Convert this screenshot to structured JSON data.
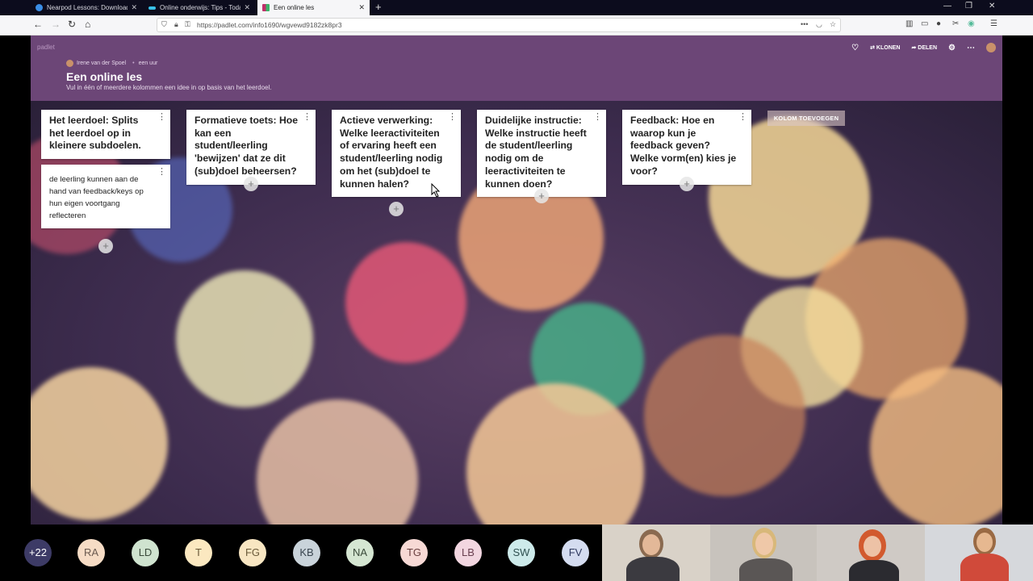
{
  "browser": {
    "tabs": [
      {
        "title": "Nearpod Lessons: Download e",
        "favicon_color": "#3a8ee6"
      },
      {
        "title": "Online onderwijs: Tips - Today",
        "favicon_color": "#39c0e8"
      },
      {
        "title": "Een online les",
        "favicon_color": "#c0306a"
      }
    ],
    "url": "https://padlet.com/info1690/wgvewd9182zk8pr3"
  },
  "padlet": {
    "brand": "padlet",
    "author": "Irene van der Spoel",
    "time": "een uur",
    "title": "Een online les",
    "description": "Vul in één of meerdere kolommen een idee in op basis van het leerdoel.",
    "actions": {
      "clone": "KLONEN",
      "share": "DELEN"
    },
    "add_column": "KOLOM TOEVOEGEN",
    "columns": [
      {
        "heading": "Het leerdoel: Splits het leerdoel op in kleinere subdoelen.",
        "posts": [
          "de leerling kunnen aan de hand van feedback/keys op hun eigen voortgang reflecteren"
        ]
      },
      {
        "heading": "Formatieve toets: Hoe kan een student/leerling 'bewijzen' dat ze dit (sub)doel beheersen?",
        "posts": []
      },
      {
        "heading": "Actieve verwerking: Welke leeractiviteiten of ervaring heeft een student/leerling nodig om het (sub)doel te kunnen halen?",
        "posts": []
      },
      {
        "heading": "Duidelijke instructie: Welke instructie heeft de student/leerling nodig om de leeractiviteiten te kunnen doen?",
        "posts": []
      },
      {
        "heading": "Feedback: Hoe en waarop kun je feedback geven? Welke vorm(en) kies je voor?",
        "posts": []
      }
    ]
  },
  "meeting": {
    "participants": [
      {
        "initials": "+22",
        "color": "#3d3b66",
        "text_color": "#ffffff"
      },
      {
        "initials": "RA",
        "color": "#f6dcc5",
        "text_color": "#6a5a50"
      },
      {
        "initials": "LD",
        "color": "#cfe3cf",
        "text_color": "#3a4a3a"
      },
      {
        "initials": "T",
        "color": "#fbe8c0",
        "text_color": "#6a5a3a"
      },
      {
        "initials": "FG",
        "color": "#f8e6c2",
        "text_color": "#6a5a3a"
      },
      {
        "initials": "KB",
        "color": "#c9d3da",
        "text_color": "#3a4650"
      },
      {
        "initials": "NA",
        "color": "#d5e6d2",
        "text_color": "#3a4a3a"
      },
      {
        "initials": "TG",
        "color": "#f7d9d5",
        "text_color": "#6a4040"
      },
      {
        "initials": "LB",
        "color": "#f2d6e0",
        "text_color": "#6a4050"
      },
      {
        "initials": "SW",
        "color": "#cdeaea",
        "text_color": "#2f5050"
      },
      {
        "initials": "FV",
        "color": "#d4dcf0",
        "text_color": "#2f3a60"
      }
    ]
  }
}
